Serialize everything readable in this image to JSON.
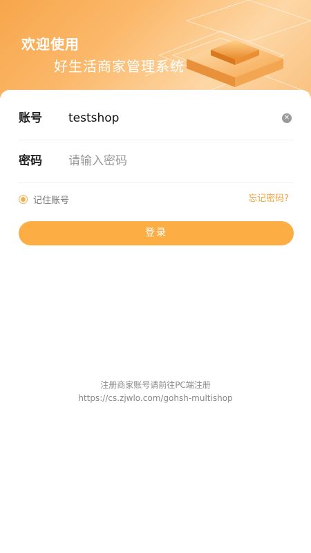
{
  "header": {
    "welcome": "欢迎使用",
    "system_name": "好生活商家管理系统"
  },
  "form": {
    "account_label": "账号",
    "account_value": "testshop",
    "password_label": "密码",
    "password_placeholder": "请输入密码",
    "remember_label": "记住账号",
    "remember_checked": true,
    "forgot_label": "忘记密码?",
    "login_label": "登录"
  },
  "footer": {
    "line1": "注册商家账号请前往PC端注册",
    "line2": "https://cs.zjwlo.com/gohsh-multishop"
  },
  "colors": {
    "accent": "#fcae45",
    "link": "#f2a33c"
  },
  "icons": {
    "clear": "clear-icon"
  }
}
